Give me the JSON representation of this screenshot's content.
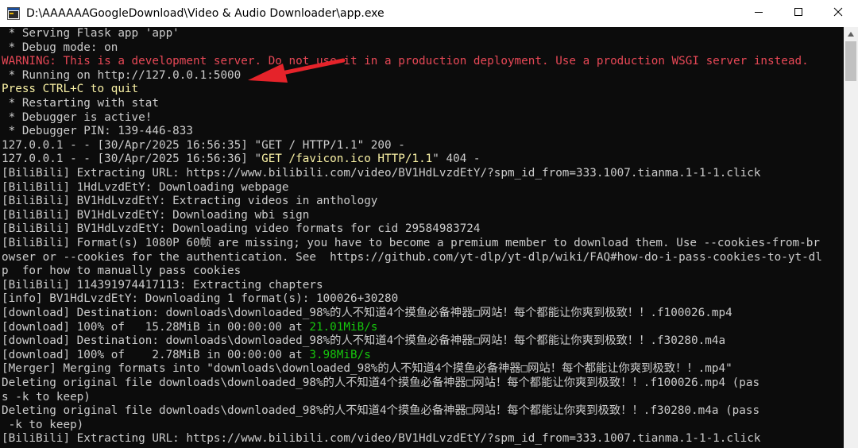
{
  "window": {
    "title": "D:\\AAAAAAGoogleDownload\\Video & Audio Downloader\\app.exe",
    "icon": "console-app-icon",
    "controls": [
      "minimize-icon",
      "maximize-icon",
      "close-icon"
    ]
  },
  "console": {
    "background": "#0c0c0c",
    "colors": {
      "default": "#cccccc",
      "warning": "#e74856",
      "yellow": "#f9f1a5",
      "green": "#16c60c"
    },
    "lines": [
      [
        {
          "t": " * Serving Flask app 'app'"
        }
      ],
      [
        {
          "t": " * Debug mode: on"
        }
      ],
      [
        {
          "t": "WARNING: This is a development server. Do not use it in a production deployment. Use a production WSGI server instead.",
          "c": "warning"
        }
      ],
      [
        {
          "t": " * Running on http://127.0.0.1:5000"
        }
      ],
      [
        {
          "t": "Press CTRL+C to quit",
          "c": "yellow"
        }
      ],
      [
        {
          "t": " * Restarting with stat"
        }
      ],
      [
        {
          "t": " * Debugger is active!"
        }
      ],
      [
        {
          "t": " * Debugger PIN: 139-446-833"
        }
      ],
      [
        {
          "t": "127.0.0.1 - - [30/Apr/2025 16:56:35] \"GET / HTTP/1.1\" 200 -"
        }
      ],
      [
        {
          "t": "127.0.0.1 - - [30/Apr/2025 16:56:36] \""
        },
        {
          "t": "GET /favicon.ico HTTP/1.1",
          "c": "yellow"
        },
        {
          "t": "\" 404 -"
        }
      ],
      [
        {
          "t": "[BiliBili] Extracting URL: https://www.bilibili.com/video/BV1HdLvzdEtY/?spm_id_from=333.1007.tianma.1-1-1.click"
        }
      ],
      [
        {
          "t": "[BiliBili] 1HdLvzdEtY: Downloading webpage"
        }
      ],
      [
        {
          "t": "[BiliBili] BV1HdLvzdEtY: Extracting videos in anthology"
        }
      ],
      [
        {
          "t": "[BiliBili] BV1HdLvzdEtY: Downloading wbi sign"
        }
      ],
      [
        {
          "t": "[BiliBili] BV1HdLvzdEtY: Downloading video formats for cid 29584983724"
        }
      ],
      [
        {
          "t": "[BiliBili] Format(s) 1080P 60帧 are missing; you have to become a premium member to download them. Use --cookies-from-br"
        }
      ],
      [
        {
          "t": "owser or --cookies for the authentication. See  https://github.com/yt-dlp/yt-dlp/wiki/FAQ#how-do-i-pass-cookies-to-yt-dl"
        }
      ],
      [
        {
          "t": "p  for how to manually pass cookies"
        }
      ],
      [
        {
          "t": "[BiliBili] 114391974417113: Extracting chapters"
        }
      ],
      [
        {
          "t": "[info] BV1HdLvzdEtY: Downloading 1 format(s): 100026+30280"
        }
      ],
      [
        {
          "t": "[download] Destination: downloads\\downloaded_98%的人不知道4个摸鱼必备神器□网站！每个都能让你爽到极致！！.f100026.mp4"
        }
      ],
      [
        {
          "t": "[download] 100% of   15.28MiB in 00:00:00 at "
        },
        {
          "t": "21.01MiB/s",
          "c": "green"
        }
      ],
      [
        {
          "t": "[download] Destination: downloads\\downloaded_98%的人不知道4个摸鱼必备神器□网站！每个都能让你爽到极致！！.f30280.m4a"
        }
      ],
      [
        {
          "t": "[download] 100% of    2.78MiB in 00:00:00 at "
        },
        {
          "t": "3.98MiB/s",
          "c": "green"
        }
      ],
      [
        {
          "t": "[Merger] Merging formats into \"downloads\\downloaded_98%的人不知道4个摸鱼必备神器□网站！每个都能让你爽到极致！！.mp4\""
        }
      ],
      [
        {
          "t": "Deleting original file downloads\\downloaded_98%的人不知道4个摸鱼必备神器□网站！每个都能让你爽到极致！！.f100026.mp4 (pas"
        }
      ],
      [
        {
          "t": "s -k to keep)"
        }
      ],
      [
        {
          "t": "Deleting original file downloads\\downloaded_98%的人不知道4个摸鱼必备神器□网站！每个都能让你爽到极致！！.f30280.m4a (pass"
        }
      ],
      [
        {
          "t": " -k to keep)"
        }
      ],
      [
        {
          "t": "[BiliBili] Extracting URL: https://www.bilibili.com/video/BV1HdLvzdEtY/?spm_id_from=333.1007.tianma.1-1-1.click"
        }
      ]
    ]
  },
  "annotation": {
    "icon": "arrow-icon",
    "color": "#e5232a"
  },
  "scrollbar": {
    "icon": "scroll-up-icon"
  }
}
